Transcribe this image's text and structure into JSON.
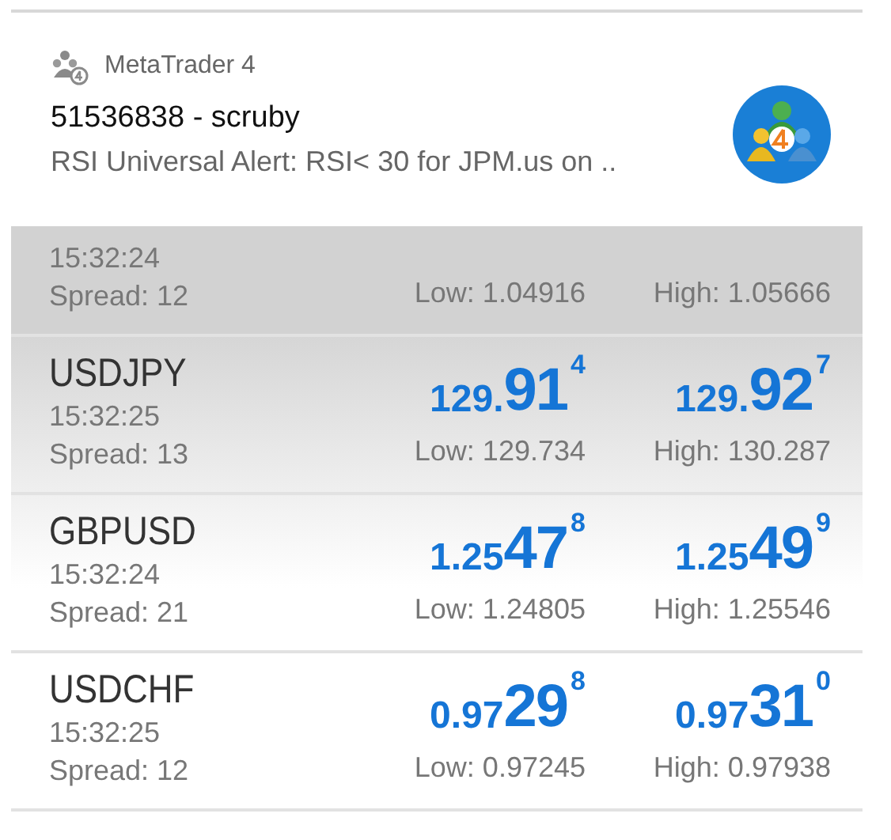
{
  "notification": {
    "app_name": "MetaTrader 4",
    "title": "51536838 - scruby",
    "text": "RSI Universal Alert: RSI< 30 for JPM.us on .."
  },
  "quotes": [
    {
      "time": "15:32:24",
      "spread": "Spread: 12",
      "low": "Low: 1.04916",
      "high": "High: 1.05666"
    },
    {
      "symbol": "USDJPY",
      "time": "15:32:25",
      "spread": "Spread: 13",
      "bid": {
        "pre": "129.",
        "big": "91",
        "pip": "4"
      },
      "ask": {
        "pre": "129.",
        "big": "92",
        "pip": "7"
      },
      "low": "Low: 129.734",
      "high": "High: 130.287"
    },
    {
      "symbol": "GBPUSD",
      "time": "15:32:24",
      "spread": "Spread: 21",
      "bid": {
        "pre": "1.25",
        "big": "47",
        "pip": "8"
      },
      "ask": {
        "pre": "1.25",
        "big": "49",
        "pip": "9"
      },
      "low": "Low: 1.24805",
      "high": "High: 1.25546"
    },
    {
      "symbol": "USDCHF",
      "time": "15:32:25",
      "spread": "Spread: 12",
      "bid": {
        "pre": "0.97",
        "big": "29",
        "pip": "8"
      },
      "ask": {
        "pre": "0.97",
        "big": "31",
        "pip": "0"
      },
      "low": "Low: 0.97245",
      "high": "High: 0.97938"
    }
  ]
}
